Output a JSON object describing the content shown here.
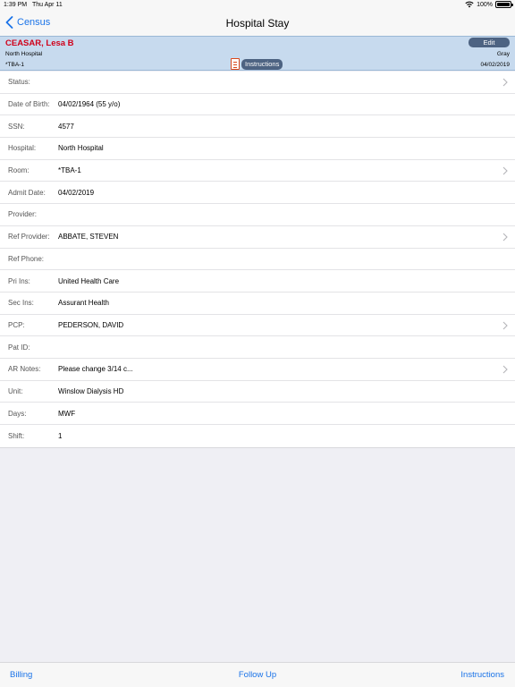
{
  "status_bar": {
    "time": "1:39 PM",
    "date": "Thu Apr 11",
    "battery": "100%"
  },
  "navbar": {
    "back_label": "Census",
    "title": "Hospital Stay"
  },
  "patient": {
    "name": "CEASAR, Lesa B",
    "hospital": "North Hospital",
    "room": "*TBA-1",
    "provider": "Gray",
    "admit_date": "04/02/2019",
    "edit_label": "Edit",
    "instructions_label": "Instructions"
  },
  "rows": [
    {
      "label": "Status:",
      "value": "",
      "chevron": true
    },
    {
      "label": "Date of Birth:",
      "value": "04/02/1964 (55 y/o)",
      "chevron": false
    },
    {
      "label": "SSN:",
      "value": "4577",
      "chevron": false
    },
    {
      "label": "Hospital:",
      "value": "North Hospital",
      "chevron": false
    },
    {
      "label": "Room:",
      "value": "*TBA-1",
      "chevron": true
    },
    {
      "label": "Admit Date:",
      "value": "04/02/2019",
      "chevron": false
    },
    {
      "label": "Provider:",
      "value": "",
      "chevron": false
    },
    {
      "label": "Ref Provider:",
      "value": "ABBATE, STEVEN",
      "chevron": true
    },
    {
      "label": "Ref Phone:",
      "value": "",
      "chevron": false
    },
    {
      "label": "Pri Ins:",
      "value": "United Health Care",
      "chevron": false
    },
    {
      "label": "Sec Ins:",
      "value": "Assurant Health",
      "chevron": false
    },
    {
      "label": "PCP:",
      "value": "PEDERSON, DAVID",
      "chevron": true
    },
    {
      "label": "Pat ID:",
      "value": "",
      "chevron": false
    },
    {
      "label": "AR Notes:",
      "value": "Please change 3/14 c...",
      "chevron": true
    },
    {
      "label": "Unit:",
      "value": "Winslow Dialysis HD",
      "chevron": false
    },
    {
      "label": "Days:",
      "value": "MWF",
      "chevron": false
    },
    {
      "label": "Shift:",
      "value": "1",
      "chevron": false
    }
  ],
  "tabbar": {
    "billing": "Billing",
    "follow_up": "Follow Up",
    "instructions": "Instructions"
  },
  "colors": {
    "accent": "#1a73e8",
    "banner": "#c7daee",
    "patient_name": "#d0021b",
    "badge_button": "#4d6382"
  }
}
